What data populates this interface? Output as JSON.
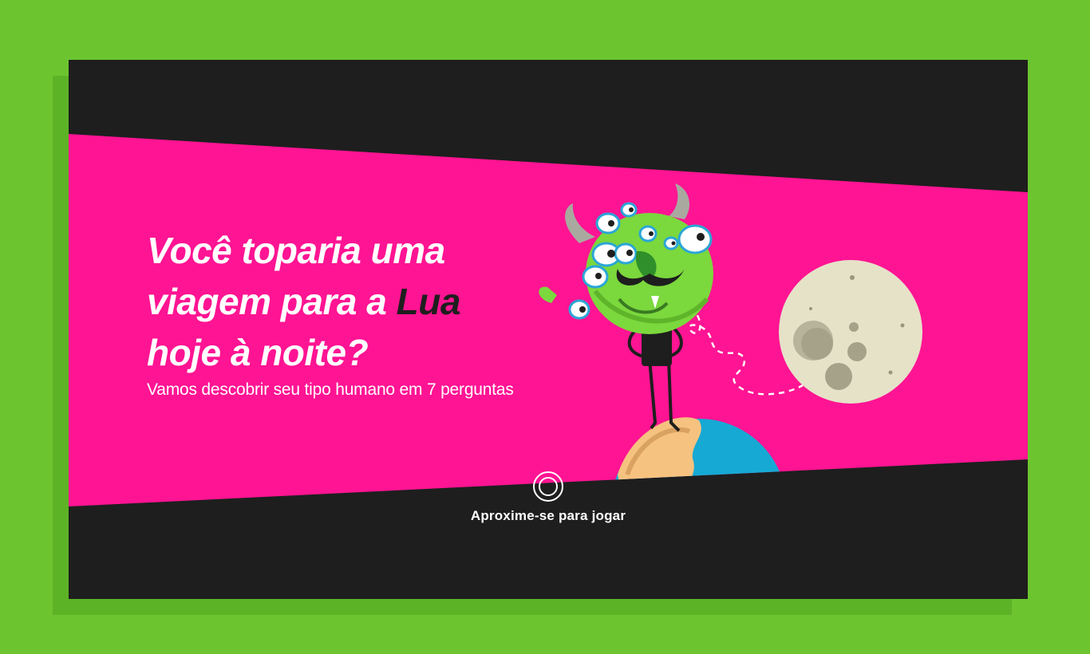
{
  "colors": {
    "background": "#6cc52f",
    "panel": "#1e1e1e",
    "band": "#ff1493",
    "text": "#ffffff"
  },
  "hero": {
    "headline_line1": "Você toparia uma",
    "headline_line2_prefix": "viagem para a ",
    "headline_accent": "Lua",
    "headline_line3": "hoje à noite?",
    "subtitle": "Vamos descobrir seu tipo humano em 7 perguntas"
  },
  "illustration": {
    "character": "green-multi-eyed-monster-icon",
    "moon": "moon-icon",
    "planet": "earth-icon"
  },
  "cta": {
    "icon": "proximity-ring-icon",
    "label": "Aproxime-se para jogar"
  }
}
